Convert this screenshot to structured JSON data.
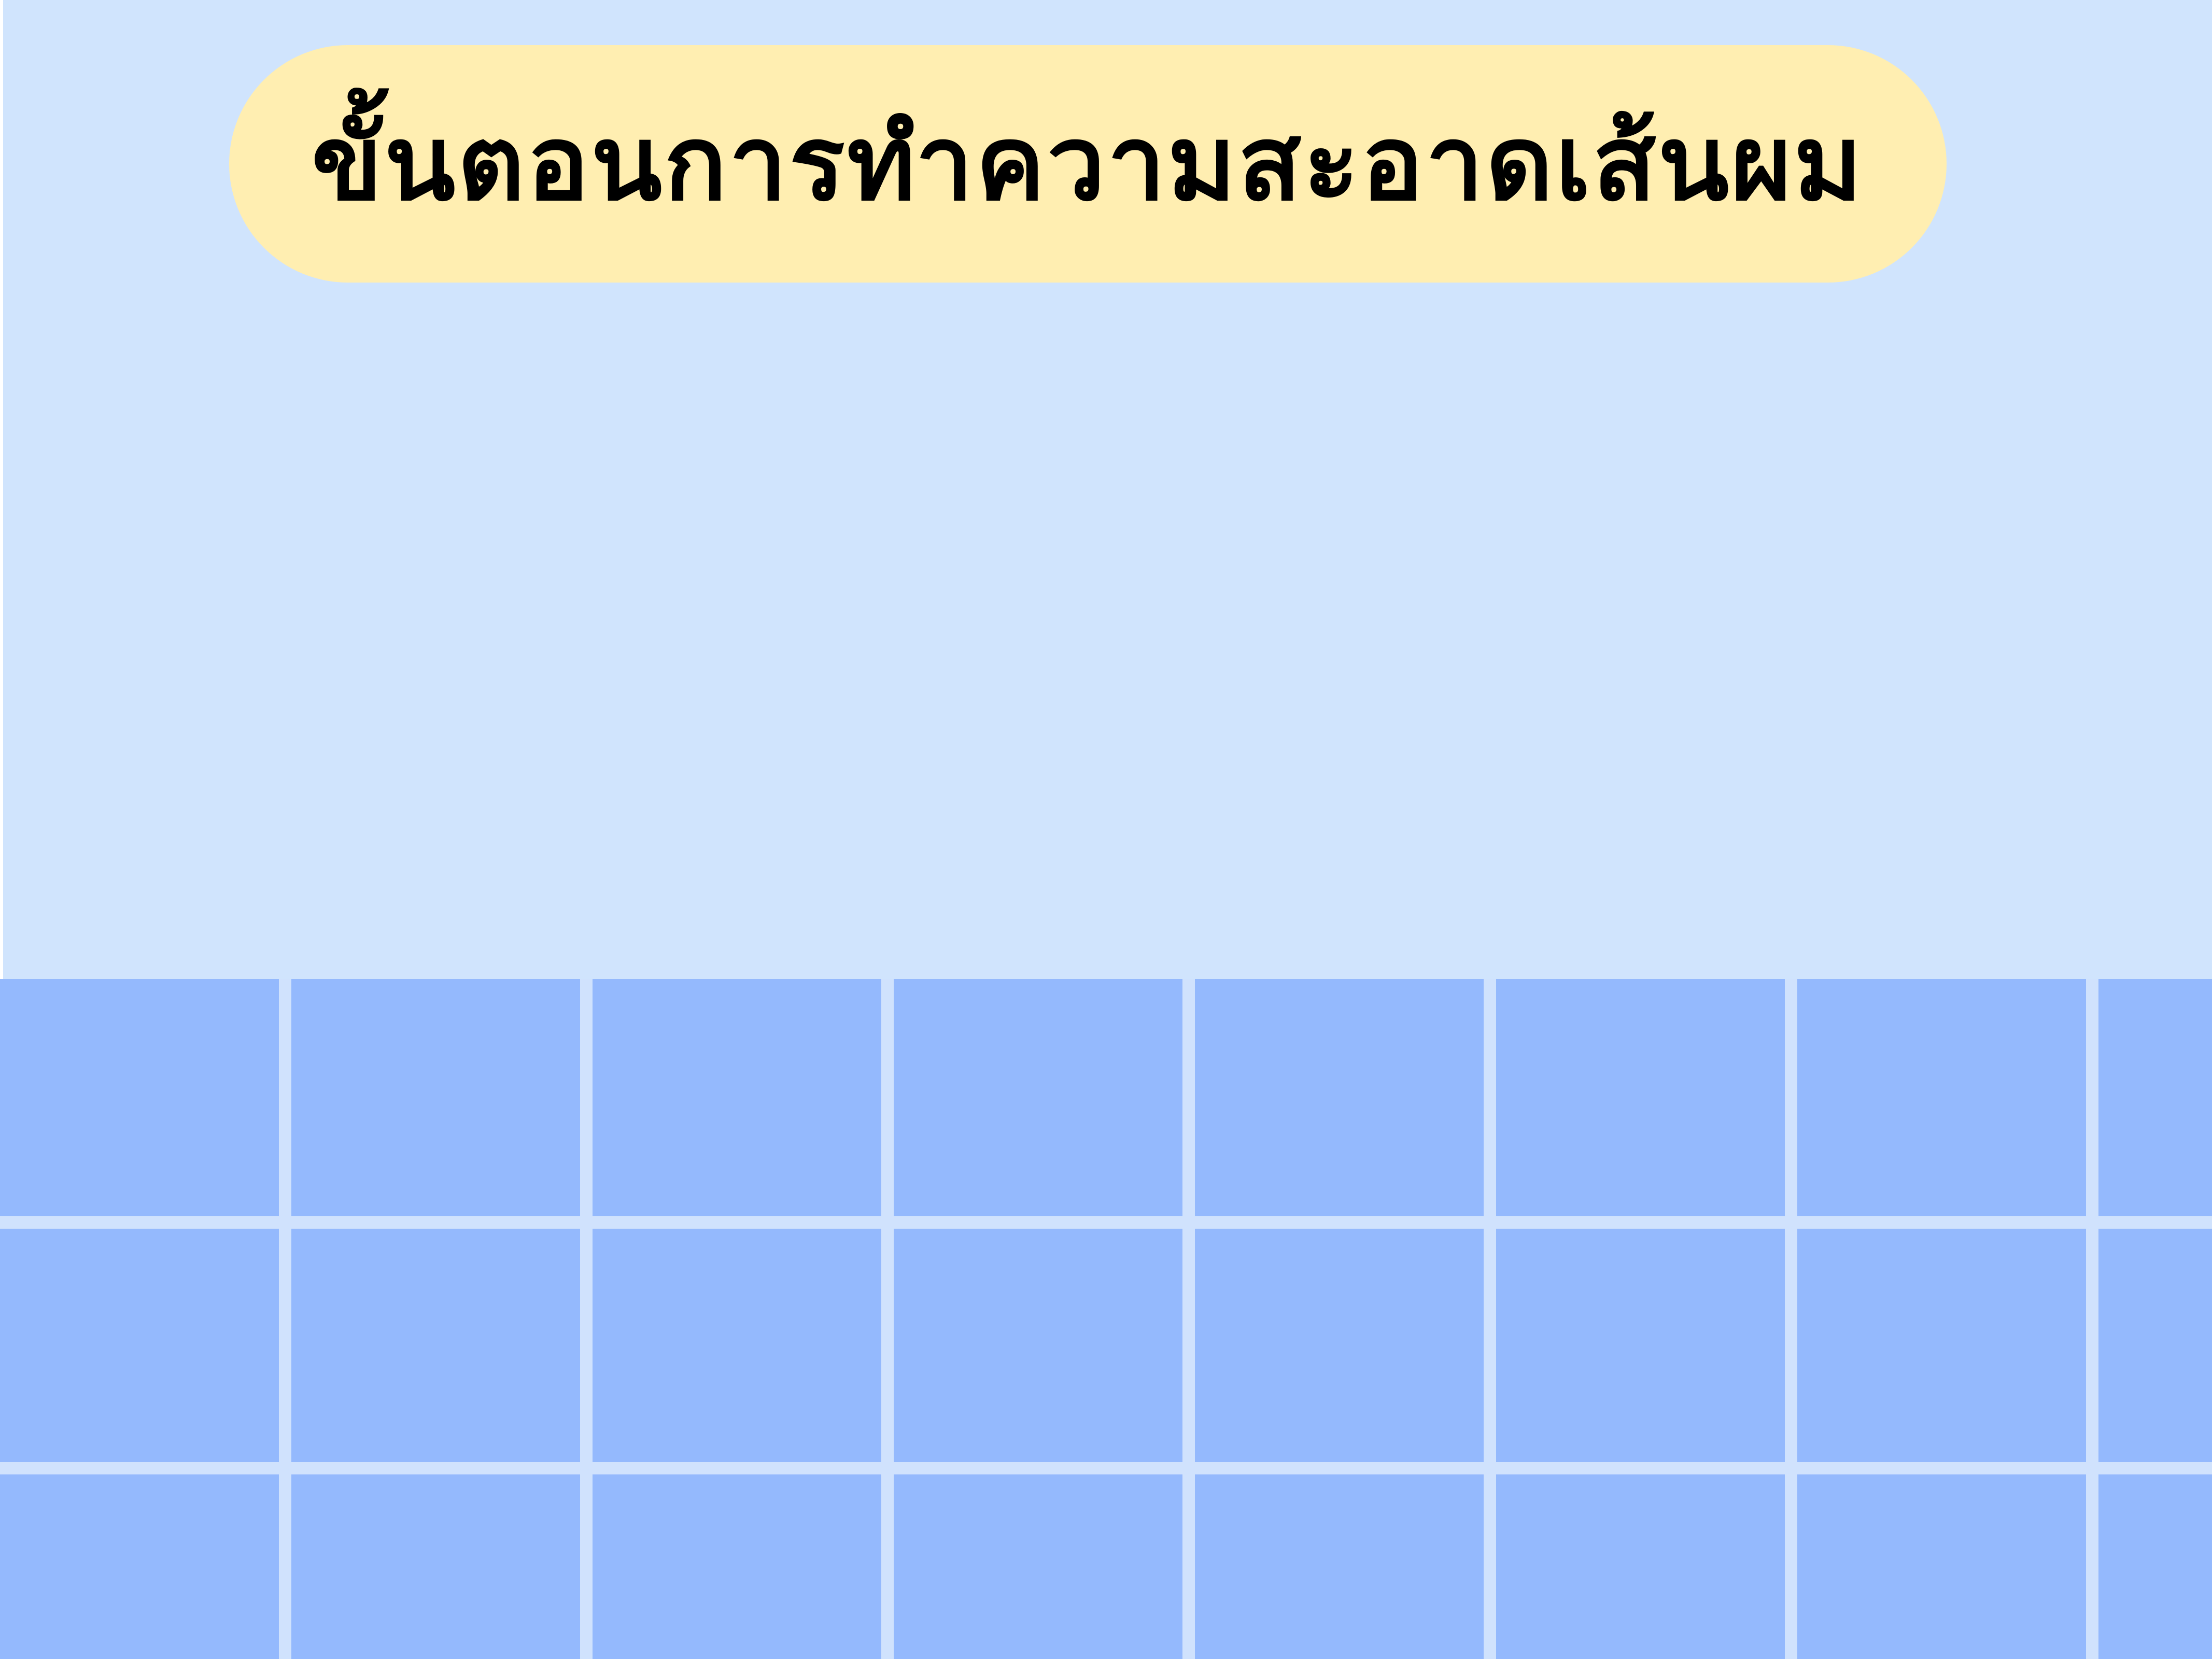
{
  "title": {
    "text": "ขั้นตอนการทำความสะอาดเส้นผม"
  },
  "colors": {
    "background": "#d0e4fd",
    "title_pill": "#ffeeb1",
    "title_text": "#000000",
    "tile": "#94b9fd",
    "grout": "#d0e2fd"
  }
}
